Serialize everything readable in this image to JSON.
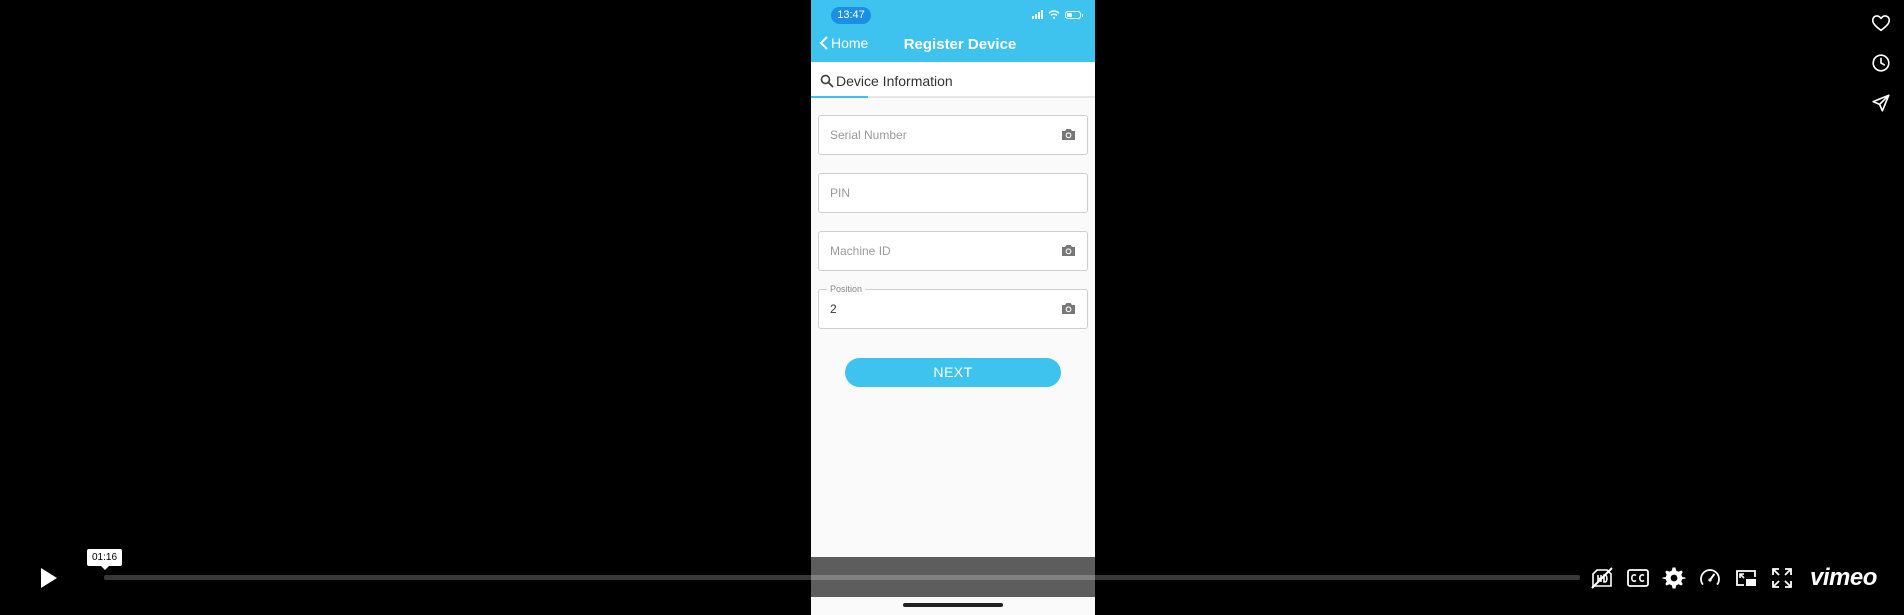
{
  "phone": {
    "status_time": "13:47",
    "battery_level": 0.45,
    "nav": {
      "back_label": "Home",
      "title": "Register Device"
    },
    "section_tab_label": "Device Information",
    "fields": {
      "serial_placeholder": "Serial Number",
      "pin_placeholder": "PIN",
      "machine_placeholder": "Machine ID",
      "position_label": "Position",
      "position_value": "2"
    },
    "next_label": "NEXT"
  },
  "player": {
    "time_tooltip": "01:16",
    "progress": 0.0,
    "logo": "vimeo"
  },
  "colors": {
    "accent": "#3ec3ef",
    "time_pill": "#1a8fe4",
    "background": "#000000"
  },
  "icons": {
    "side": [
      "heart-icon",
      "clock-icon",
      "send-icon"
    ],
    "controls": [
      "play-icon",
      "hd-off-icon",
      "cc-icon",
      "gear-icon",
      "speed-icon",
      "pip-icon",
      "fullscreen-icon"
    ],
    "fields": [
      "camera-icon",
      "search-icon",
      "chevron-left-icon"
    ]
  }
}
